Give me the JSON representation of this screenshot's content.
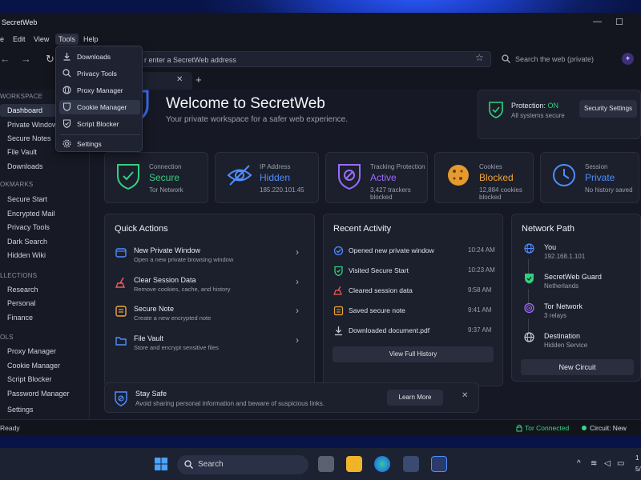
{
  "app": {
    "title": "SecretWeb"
  },
  "menu": {
    "file": "e",
    "edit": "Edit",
    "view": "View",
    "tools": "Tools",
    "help": "Help"
  },
  "tools_menu": [
    "Downloads",
    "Privacy Tools",
    "Proxy Manager",
    "Cookie Manager",
    "Script Blocker",
    "Settings"
  ],
  "nav": {
    "url_placeholder": "r enter a SecretWeb address",
    "search_placeholder": "Search the web (private)"
  },
  "sidebar": {
    "sections": [
      {
        "title": "WORKSPACE",
        "items": [
          "Dashboard",
          "Private Window",
          "Secure Notes",
          "File Vault",
          "Downloads"
        ]
      },
      {
        "title": "OKMARKS",
        "items": [
          "Secure Start",
          "Encrypted Mail",
          "Privacy Tools",
          "Dark Search",
          "Hidden Wiki"
        ]
      },
      {
        "title": "LLECTIONS",
        "items": [
          "Research",
          "Personal",
          "Finance"
        ]
      },
      {
        "title": "OLS",
        "items": [
          "Proxy Manager",
          "Cookie Manager",
          "Script Blocker",
          "Password Manager"
        ]
      }
    ],
    "settings": "Settings"
  },
  "hero": {
    "title": "Welcome to SecretWeb",
    "subtitle": "Your private workspace for a safer web experience."
  },
  "protection": {
    "label": "Protection:",
    "status": "ON",
    "sub": "All systems secure",
    "button": "Security Settings"
  },
  "stats": [
    {
      "label": "Connection",
      "value": "Secure",
      "sub": "Tor Network",
      "color": "#35d07f"
    },
    {
      "label": "IP Address",
      "value": "Hidden",
      "sub": "185.220.101.45",
      "color": "#4f8dff"
    },
    {
      "label": "Tracking Protection",
      "value": "Active",
      "sub": "3,427 trackers blocked",
      "color": "#9b6bff"
    },
    {
      "label": "Cookies",
      "value": "Blocked",
      "sub": "12,884 cookies blocked",
      "color": "#f0a63a"
    },
    {
      "label": "Session",
      "value": "Private",
      "sub": "No history saved",
      "color": "#4f8dff"
    }
  ],
  "quick_actions": {
    "title": "Quick Actions",
    "items": [
      {
        "name": "New Private Window",
        "desc": "Open a new private browsing window"
      },
      {
        "name": "Clear Session Data",
        "desc": "Remove cookies, cache, and history"
      },
      {
        "name": "Secure Note",
        "desc": "Create a new encrypted note"
      },
      {
        "name": "File Vault",
        "desc": "Store and encrypt sensitive files"
      }
    ]
  },
  "recent": {
    "title": "Recent Activity",
    "button": "View Full History",
    "items": [
      {
        "text": "Opened new private window",
        "time": "10:24 AM"
      },
      {
        "text": "Visited Secure Start",
        "time": "10:23 AM"
      },
      {
        "text": "Cleared session data",
        "time": "9:58 AM"
      },
      {
        "text": "Saved secure note",
        "time": "9:41 AM"
      },
      {
        "text": "Downloaded document.pdf",
        "time": "9:37 AM"
      }
    ]
  },
  "network": {
    "title": "Network Path",
    "button": "New Circuit",
    "nodes": [
      {
        "name": "You",
        "detail": "192.168.1.101"
      },
      {
        "name": "SecretWeb Guard",
        "detail": "Netherlands"
      },
      {
        "name": "Tor Network",
        "detail": "3 relays"
      },
      {
        "name": "Destination",
        "detail": "Hidden Service"
      }
    ]
  },
  "tip": {
    "title": "Stay Safe",
    "desc": "Avoid sharing personal information and beware of suspicious links.",
    "button": "Learn More"
  },
  "status": {
    "left": "Ready",
    "tor": "Tor Connected",
    "circuit": "Circuit: New"
  },
  "taskbar": {
    "search": "Search",
    "clock_partial": "1",
    "date_partial": "5/"
  }
}
